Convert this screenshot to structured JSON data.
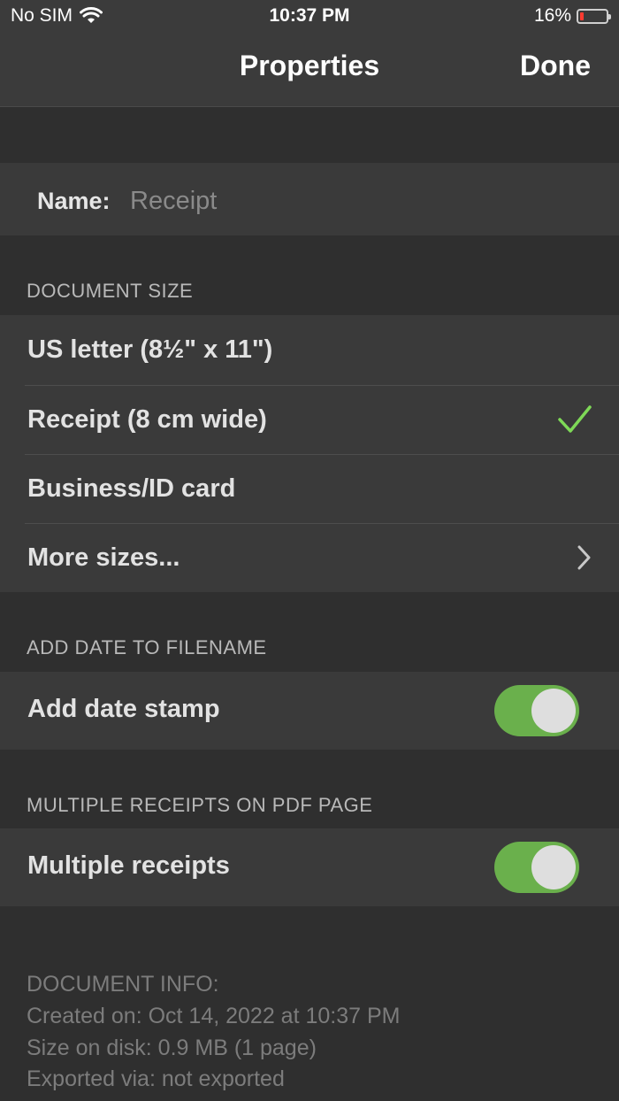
{
  "status_bar": {
    "carrier": "No SIM",
    "time": "10:37 PM",
    "battery_percent": "16%",
    "battery_level": 0.16,
    "wifi_icon": "wifi-icon",
    "battery_color": "#ff3b30"
  },
  "nav": {
    "title": "Properties",
    "done_label": "Done"
  },
  "name_field": {
    "label": "Name:",
    "placeholder": "Receipt",
    "value": ""
  },
  "document_size": {
    "header": "DOCUMENT SIZE",
    "options": [
      {
        "label": "US letter (8½\" x 11\")",
        "selected": false
      },
      {
        "label": "Receipt (8 cm wide)",
        "selected": true
      },
      {
        "label": "Business/ID card",
        "selected": false
      },
      {
        "label": "More sizes...",
        "selected": false
      }
    ]
  },
  "date_section": {
    "header": "ADD DATE TO FILENAME",
    "label": "Add date stamp",
    "enabled": true
  },
  "multiple_section": {
    "header": "MULTIPLE RECEIPTS ON PDF PAGE",
    "label": "Multiple receipts",
    "enabled": true
  },
  "document_info": {
    "header": "DOCUMENT INFO:",
    "created": "Created on: Oct 14, 2022 at 10:37 PM",
    "size": "Size on disk: 0.9 MB (1 page)",
    "exported": "Exported via: not exported"
  },
  "colors": {
    "accent_check": "#7ed957",
    "toggle_on": "#6ab04c",
    "background": "#2f2f2f",
    "row_background": "#3a3a3a"
  }
}
